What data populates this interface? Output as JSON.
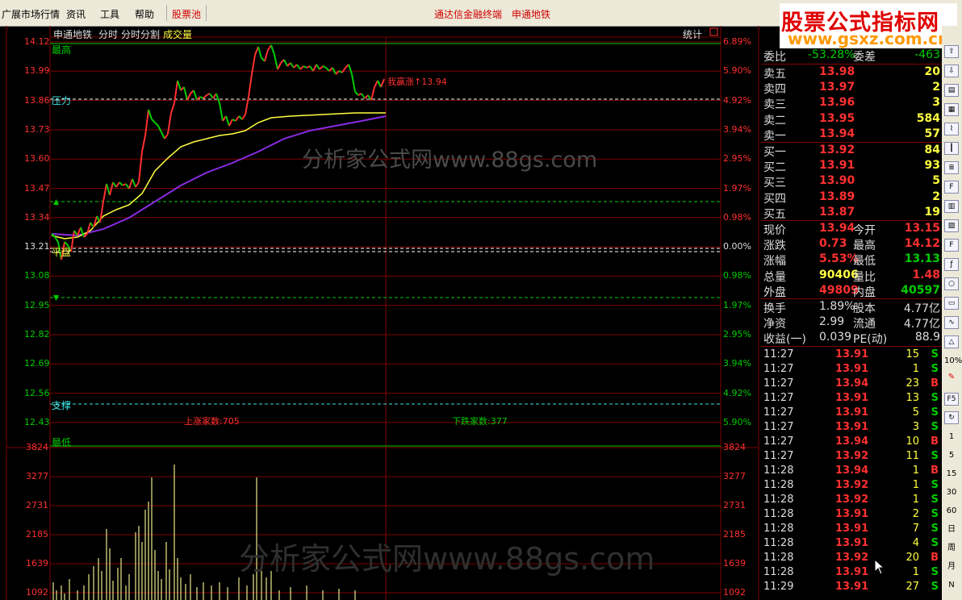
{
  "menu": {
    "m1": "广展市场行情",
    "m2": "资讯",
    "m3": "工具",
    "m4": "帮助",
    "m5": "股票池",
    "m6": "通达信金融终端",
    "m7": "申通地铁"
  },
  "logo": {
    "line1": "股票公式指标网",
    "line2": "www.gsxz.com.cn"
  },
  "chart": {
    "name": "申通地铁",
    "tab1": "分时",
    "tab2": "分时分割",
    "tab3": "成交量",
    "stat": "统计",
    "high_label": "最高",
    "low_label": "最低",
    "pressure_label": "压力",
    "support_label": "支撑",
    "flat_label": "平盘",
    "callout": "我赢涨↑13.94",
    "up_count": "上涨家数:705",
    "down_count": "下跌家数:377",
    "watermark1": "分析家公式网www.88gs.com",
    "watermark2": "分析家公式网www.88gs.com"
  },
  "price_labels": [
    "14.12",
    "13.99",
    "13.86",
    "13.73",
    "13.60",
    "13.47",
    "13.34",
    "13.21",
    "13.08",
    "12.95",
    "12.82",
    "12.69",
    "12.56",
    "12.43"
  ],
  "pct_labels": [
    "6.89%",
    "5.90%",
    "4.92%",
    "3.94%",
    "2.95%",
    "1.97%",
    "0.98%",
    "0.00%",
    "0.98%",
    "1.97%",
    "2.95%",
    "3.94%",
    "4.92%",
    "5.90%"
  ],
  "vol_labels": [
    "3824",
    "3277",
    "2731",
    "2185",
    "1639",
    "1092"
  ],
  "quote": {
    "wb_label": "委比",
    "wb_value": "-53.28%",
    "wc_label": "委差",
    "wc_value": "-463",
    "asks": [
      {
        "label": "卖五",
        "price": "13.98",
        "vol": "20"
      },
      {
        "label": "卖四",
        "price": "13.97",
        "vol": "2"
      },
      {
        "label": "卖三",
        "price": "13.96",
        "vol": "3"
      },
      {
        "label": "卖二",
        "price": "13.95",
        "vol": "584"
      },
      {
        "label": "卖一",
        "price": "13.94",
        "vol": "57"
      }
    ],
    "bids": [
      {
        "label": "买一",
        "price": "13.92",
        "vol": "84"
      },
      {
        "label": "买二",
        "price": "13.91",
        "vol": "93"
      },
      {
        "label": "买三",
        "price": "13.90",
        "vol": "5"
      },
      {
        "label": "买四",
        "price": "13.89",
        "vol": "2"
      },
      {
        "label": "买五",
        "price": "13.87",
        "vol": "19"
      }
    ],
    "stats": [
      {
        "l1": "现价",
        "v1": "13.94",
        "l2": "今开",
        "v2": "13.15"
      },
      {
        "l1": "涨跌",
        "v1": "0.73",
        "l2": "最高",
        "v2": "14.12"
      },
      {
        "l1": "涨幅",
        "v1": "5.53%",
        "l2": "最低",
        "v2": "13.13"
      },
      {
        "l1": "总量",
        "v1": "90406",
        "l2": "量比",
        "v2": "1.48"
      },
      {
        "l1": "外盘",
        "v1": "49809",
        "l2": "内盘",
        "v2": "40597"
      }
    ],
    "stats2": [
      {
        "l1": "换手",
        "v1": "1.89%",
        "l2": "股本",
        "v2": "4.77亿"
      },
      {
        "l1": "净资",
        "v1": "2.99",
        "l2": "流通",
        "v2": "4.77亿"
      },
      {
        "l1": "收益(一)",
        "v1": "0.039",
        "l2": "PE(动)",
        "v2": "88.9"
      }
    ],
    "trades": [
      {
        "t": "11:27",
        "p": "13.91",
        "v": "15",
        "d": "S"
      },
      {
        "t": "11:27",
        "p": "13.91",
        "v": "1",
        "d": "S"
      },
      {
        "t": "11:27",
        "p": "13.94",
        "v": "23",
        "d": "B"
      },
      {
        "t": "11:27",
        "p": "13.91",
        "v": "13",
        "d": "S"
      },
      {
        "t": "11:27",
        "p": "13.91",
        "v": "5",
        "d": "S"
      },
      {
        "t": "11:27",
        "p": "13.91",
        "v": "3",
        "d": "S"
      },
      {
        "t": "11:27",
        "p": "13.94",
        "v": "10",
        "d": "B"
      },
      {
        "t": "11:27",
        "p": "13.92",
        "v": "11",
        "d": "S"
      },
      {
        "t": "11:28",
        "p": "13.94",
        "v": "1",
        "d": "B"
      },
      {
        "t": "11:28",
        "p": "13.92",
        "v": "1",
        "d": "S"
      },
      {
        "t": "11:28",
        "p": "13.92",
        "v": "1",
        "d": "S"
      },
      {
        "t": "11:28",
        "p": "13.91",
        "v": "2",
        "d": "S"
      },
      {
        "t": "11:28",
        "p": "13.91",
        "v": "7",
        "d": "S"
      },
      {
        "t": "11:28",
        "p": "13.91",
        "v": "4",
        "d": "S"
      },
      {
        "t": "11:28",
        "p": "13.92",
        "v": "20",
        "d": "B"
      },
      {
        "t": "11:28",
        "p": "13.91",
        "v": "1",
        "d": "S"
      },
      {
        "t": "11:29",
        "p": "13.91",
        "v": "27",
        "d": "S"
      }
    ]
  },
  "toolbar_labels": [
    "10%",
    "F5",
    "1",
    "5",
    "15",
    "30",
    "60",
    "日",
    "周",
    "月",
    "N"
  ],
  "colors": {
    "red": "#ff3030",
    "green": "#00cc00",
    "yellow": "#ffff40",
    "purple": "#8a2be2",
    "cyan": "#40e0e0",
    "grid": "#800000"
  }
}
